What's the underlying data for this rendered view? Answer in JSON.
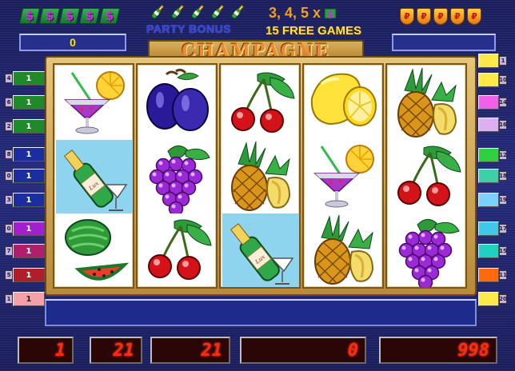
{
  "header": {
    "bonus_label": "PARTY BONUS",
    "scatter_label": "3, 4, 5 x",
    "free_games_label": "15 FREE GAMES",
    "win_display": "0",
    "title": "CHAMPAGNE",
    "dollar_icon_glyph": "$",
    "shield_icon_glyph": "₽"
  },
  "lines_left": [
    {
      "num": "4",
      "value": "1",
      "color": "#1f8a2a"
    },
    {
      "num": "6",
      "value": "1",
      "color": "#1f8a2a"
    },
    {
      "num": "2",
      "value": "1",
      "color": "#1f8a2a"
    },
    {
      "num": "8",
      "value": "1",
      "color": "#1a2e9e"
    },
    {
      "num": "0",
      "value": "1",
      "color": "#1a2e9e"
    },
    {
      "num": "3",
      "value": "1",
      "color": "#1a2e9e"
    },
    {
      "num": "0",
      "value": "1",
      "color": "#a020d0"
    },
    {
      "num": "7",
      "value": "1",
      "color": "#b01e6e"
    },
    {
      "num": "5",
      "value": "1",
      "color": "#b01e2a"
    },
    {
      "num": "1",
      "value": "1",
      "color": "#f4a0a8"
    }
  ],
  "lines_right": [
    {
      "num": "1",
      "value": "",
      "color": "#ffe84a"
    },
    {
      "num": "10",
      "value": "",
      "color": "#ffe84a"
    },
    {
      "num": "14",
      "value": "",
      "color": "#f060e8"
    },
    {
      "num": "16",
      "value": "",
      "color": "#dcb0f0"
    },
    {
      "num": "12",
      "value": "",
      "color": "#2fd040"
    },
    {
      "num": "18",
      "value": "",
      "color": "#40d0a8"
    },
    {
      "num": "19",
      "value": "",
      "color": "#7ad0ff"
    },
    {
      "num": "17",
      "value": "",
      "color": "#40c8e8"
    },
    {
      "num": "15",
      "value": "",
      "color": "#20d0c0"
    },
    {
      "num": "11",
      "value": "",
      "color": "#ff6a10"
    },
    {
      "num": "20",
      "value": "",
      "color": "#ffe84a"
    }
  ],
  "reels": [
    [
      "cocktail",
      "champagne",
      "watermelon"
    ],
    [
      "plum",
      "grapes",
      "cherry"
    ],
    [
      "cherry",
      "pineapple",
      "champagne"
    ],
    [
      "lemon",
      "cocktail",
      "pineapple"
    ],
    [
      "pineapple",
      "cherry",
      "grapes"
    ]
  ],
  "highlighted_cells": [
    [
      0,
      1
    ],
    [
      2,
      2
    ]
  ],
  "bottom": {
    "message": "",
    "lines": "1",
    "bet_per_line": "21",
    "total_bet": "21",
    "win": "0",
    "credit": "998"
  },
  "colors": {
    "background": "#1c2060",
    "frame_gold": "#d9b060",
    "led_text": "#ff2a10",
    "title_orange": "#f08a30"
  }
}
